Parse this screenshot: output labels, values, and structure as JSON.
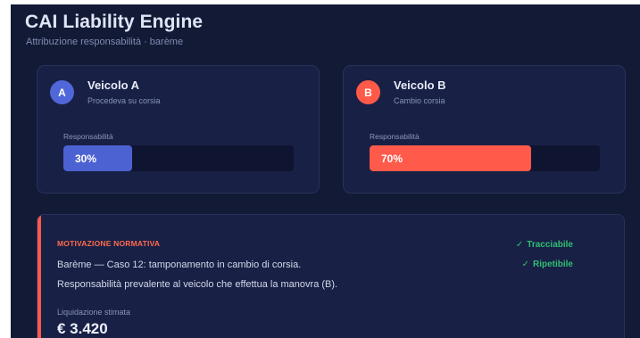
{
  "app": {
    "title": "CAI Liability Engine",
    "subtitle": "Attribuzione responsabilità · barème"
  },
  "vehicles": [
    {
      "badge": "A",
      "name": "Veicolo A",
      "description": "Procedeva su corsia",
      "responsibility_label": "Responsabilità",
      "responsibility_text": "30%",
      "responsibility_pct": 30,
      "color": "#4d62d2"
    },
    {
      "badge": "B",
      "name": "Veicolo B",
      "description": "Cambio corsia",
      "responsibility_label": "Responsabilità",
      "responsibility_text": "70%",
      "responsibility_pct": 70,
      "color": "#ff5a4a"
    }
  ],
  "motivation": {
    "heading": "MOTIVAZIONE NORMATIVA",
    "line1": "Barème — Caso 12: tamponamento in cambio di corsia.",
    "line2": "Responsabilità prevalente al veicolo che effettua la manovra (B).",
    "checks": [
      {
        "icon": "check-icon",
        "label": "Tracciabile"
      },
      {
        "icon": "check-icon",
        "label": "Ripetibile"
      }
    ],
    "estimate_label": "Liquidazione stimata",
    "estimate_value": "€ 3.420"
  },
  "colors": {
    "background": "#131a35",
    "card": "#182045",
    "accent_red": "#ff5a48",
    "accent_blue": "#4f67d8",
    "success": "#2fbf71"
  }
}
